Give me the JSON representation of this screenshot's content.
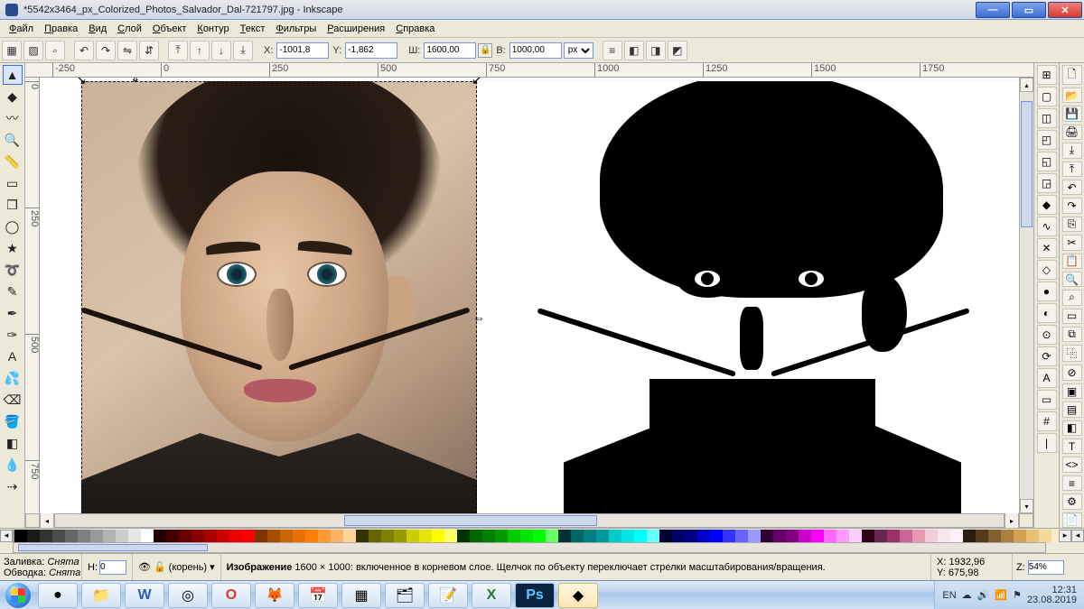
{
  "title": "*5542x3464_px_Colorized_Photos_Salvador_Dal-721797.jpg - Inkscape",
  "menu": [
    "Файл",
    "Правка",
    "Вид",
    "Слой",
    "Объект",
    "Контур",
    "Текст",
    "Фильтры",
    "Расширения",
    "Справка"
  ],
  "coords": {
    "x_label": "X:",
    "x": "-1001,8",
    "y_label": "Y:",
    "y": "-1,862",
    "w_label": "Ш:",
    "w": "1600,00",
    "h_label": "В:",
    "h": "1000,00",
    "unit": "px"
  },
  "ruler_ticks_h": [
    "-250",
    "0",
    "250",
    "500",
    "750",
    "1000",
    "1250",
    "1500",
    "1750"
  ],
  "ruler_ticks_v": [
    "0",
    "250",
    "500",
    "750"
  ],
  "palette_hex": [
    "none",
    "#000000",
    "#1a1a1a",
    "#333333",
    "#4d4d4d",
    "#666666",
    "#808080",
    "#999999",
    "#b3b3b3",
    "#cccccc",
    "#e6e6e6",
    "#ffffff",
    "#220000",
    "#440000",
    "#660000",
    "#880000",
    "#aa0000",
    "#cc0000",
    "#ee0000",
    "#ff0000",
    "#803300",
    "#a64d00",
    "#cc6600",
    "#e67300",
    "#ff8000",
    "#ff9933",
    "#ffb366",
    "#ffd699",
    "#333300",
    "#666600",
    "#808000",
    "#999900",
    "#cccc00",
    "#e6e600",
    "#ffff00",
    "#ffff66",
    "#003300",
    "#006600",
    "#008000",
    "#009900",
    "#00cc00",
    "#00e600",
    "#00ff00",
    "#66ff66",
    "#003333",
    "#006666",
    "#008080",
    "#009999",
    "#00cccc",
    "#00e6e6",
    "#00ffff",
    "#66ffff",
    "#000033",
    "#000066",
    "#000080",
    "#0000cc",
    "#0000ff",
    "#3333ff",
    "#6666ff",
    "#9999ff",
    "#330033",
    "#660066",
    "#800080",
    "#cc00cc",
    "#ff00ff",
    "#ff66ff",
    "#ff99ff",
    "#ffccff",
    "#330019",
    "#66264d",
    "#993366",
    "#cc6699",
    "#e699b3",
    "#f2cdd9",
    "#f9e6ec",
    "#fff2f6",
    "#2b1d0e",
    "#553a1b",
    "#806030",
    "#aa8040",
    "#d4a050",
    "#e8c070",
    "#f2d99b",
    "#faecc8"
  ],
  "status": {
    "fill_label": "Заливка:",
    "fill_value": "Снята",
    "stroke_label": "Обводка:",
    "stroke_value": "Снята",
    "h_label": "Н:",
    "h_value": "0",
    "layer": "(корень)",
    "msg_bold": "Изображение",
    "msg_rest": "1600 × 1000: включенное в корневом слое. Щелчок по объекту переключает стрелки масштабирования/вращения.",
    "cx_label": "X:",
    "cx": "1932,96",
    "cy_label": "Y:",
    "cy": "675,98",
    "z_label": "Z:",
    "zoom": "54%"
  },
  "tray": {
    "lang": "EN",
    "time": "12:31",
    "date": "23.08.2019"
  }
}
